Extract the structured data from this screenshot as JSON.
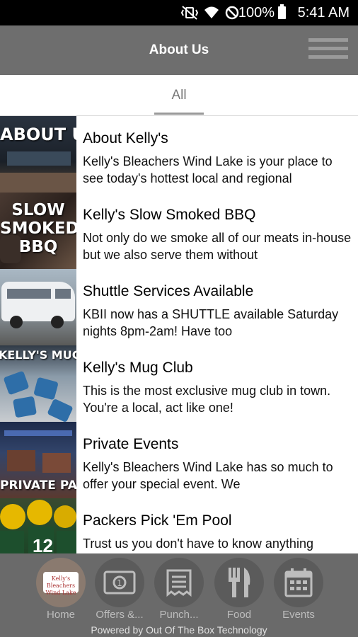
{
  "status_bar": {
    "battery": "100%",
    "time": "5:41 AM"
  },
  "header": {
    "title": "About Us"
  },
  "tabs": {
    "active": "All"
  },
  "items": [
    {
      "image_caption": "ABOUT US",
      "title": "About Kelly's",
      "desc": "Kelly's Bleachers Wind Lake is your place to see today's hottest local and regional"
    },
    {
      "image_caption_1": "SLOW",
      "image_caption_2": "SMOKED",
      "image_caption_3": "BBQ",
      "title": "Kelly's Slow Smoked BBQ",
      "desc": "Not only do we smoke all of our meats in-house but we also serve them without"
    },
    {
      "title": "Shuttle Services Available",
      "desc": "KBII now has a SHUTTLE available Saturday nights 8pm-2am! Have too"
    },
    {
      "image_caption": "KELLY'S MUG CL",
      "title": "Kelly's Mug Club",
      "desc": "This is the most exclusive mug club in town. You're a local, act like one!"
    },
    {
      "image_caption": "PRIVATE PART",
      "title": "Private Events",
      "desc": "Kelly's Bleachers Wind Lake has so much to offer your special event. We"
    },
    {
      "title": "Packers Pick 'Em Pool",
      "desc": "Trust us you don't have to know anything"
    }
  ],
  "bottom_nav": {
    "home": {
      "label": "Home",
      "logo_text": "Kelly's Bleachers Wind Lake"
    },
    "offers": {
      "label": "Offers &..."
    },
    "punch": {
      "label": "Punch..."
    },
    "food": {
      "label": "Food"
    },
    "events": {
      "label": "Events"
    }
  },
  "powered_by": "Powered by Out Of The Box Technology"
}
